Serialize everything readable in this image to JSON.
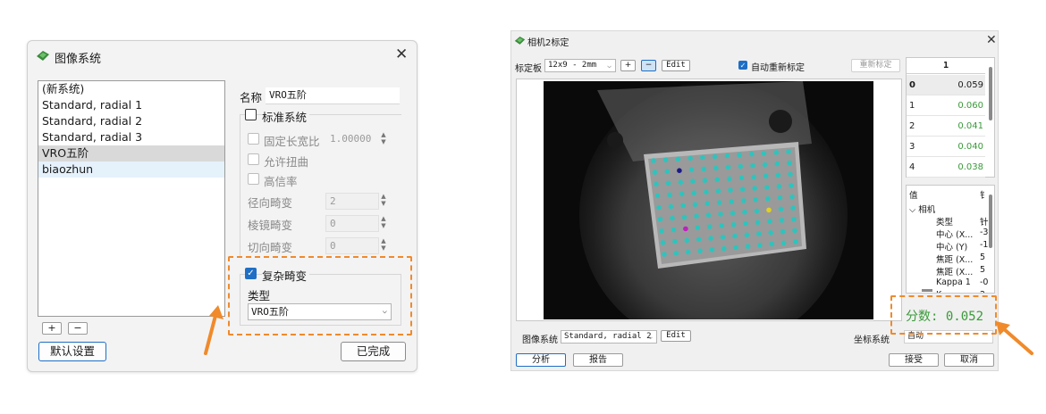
{
  "system_dialog": {
    "title": "图像系统",
    "systems": [
      "(新系统)",
      "Standard, radial 1",
      "Standard, radial 2",
      "Standard, radial 3",
      "VRO五阶",
      "biaozhun"
    ],
    "add_label": "+",
    "remove_label": "−",
    "default_button": "默认设置",
    "done_button": "已完成",
    "name_label": "名称",
    "name_value": "VRO五阶",
    "standard_system_label": "标准系统",
    "fixed_aspect_label": "固定长宽比",
    "fixed_aspect_value": "1.00000",
    "allow_skew_label": "允许扭曲",
    "telecentric_label": "高信率",
    "radial_label": "径向畸变",
    "radial_value": "2",
    "prism_label": "棱镜畸变",
    "prism_value": "0",
    "tangential_label": "切向畸变",
    "tangential_value": "0",
    "complex_label": "复杂畸变",
    "type_label": "类型",
    "type_value": "VRO五阶"
  },
  "calib_dialog": {
    "title": "相机2标定",
    "board_label": "标定板",
    "board_value": "12x9 - 2mm",
    "plus_label": "+",
    "minus_label": "−",
    "edit_label": "Edit",
    "auto_recalib_label": "自动重新标定",
    "recalib_button": "重新标定",
    "table_header": "1",
    "table_rows": [
      {
        "index": "0",
        "value": "0.059"
      },
      {
        "index": "1",
        "value": "0.060"
      },
      {
        "index": "2",
        "value": "0.041"
      },
      {
        "index": "3",
        "value": "0.040"
      },
      {
        "index": "4",
        "value": "0.038"
      }
    ],
    "tree_header": "值",
    "tree_header2": "钅",
    "tree_root": "相机",
    "tree_items": [
      {
        "label": "类型",
        "value": "针"
      },
      {
        "label": "中心 (X...",
        "value": "-3"
      },
      {
        "label": "中心 (Y)",
        "value": "-1"
      },
      {
        "label": "焦距 (X...",
        "value": "5"
      },
      {
        "label": "焦距 (X...",
        "value": "5"
      },
      {
        "label": "Kappa 1",
        "value": "-0"
      },
      {
        "label": "K...",
        "value": "2"
      }
    ],
    "score_text": "分数:  0.052",
    "image_system_label": "图像系统",
    "image_system_value": "Standard, radial 2",
    "coord_system_label": "坐标系统",
    "coord_system_value": "自动",
    "analyze_button": "分析",
    "report_button": "报告",
    "accept_button": "接受",
    "cancel_button": "取消"
  },
  "colors": {
    "accent": "#1f6fc5",
    "highlight": "#f08a2b",
    "good_value": "#3a9a3a",
    "dot": "#2ec4bd"
  }
}
